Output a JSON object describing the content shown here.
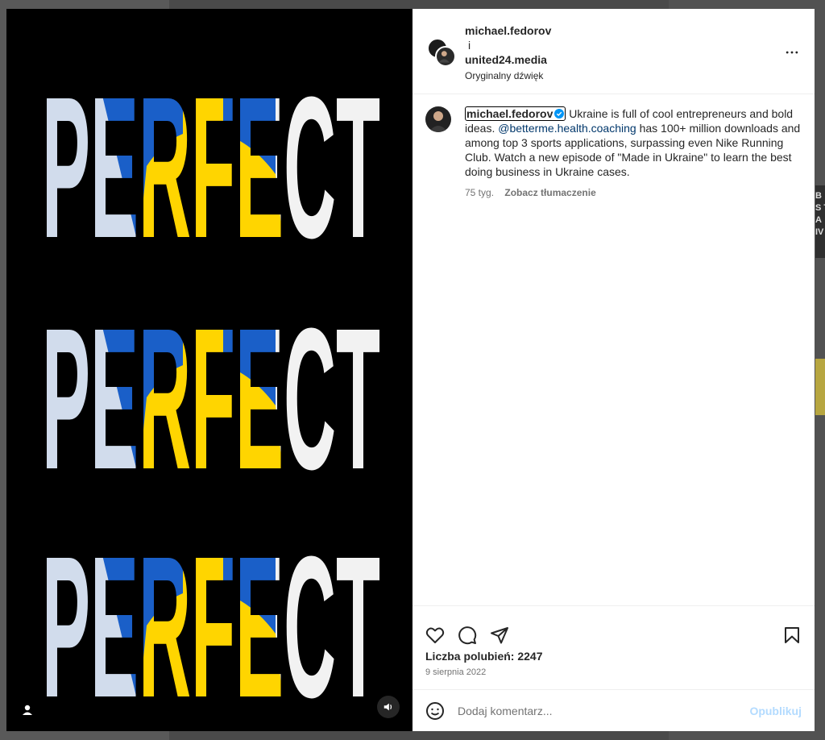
{
  "post": {
    "author": "michael.fedorov",
    "joiner": "i",
    "coauthor": "united24.media",
    "audio": "Oryginalny dźwięk"
  },
  "caption": {
    "user": "michael.fedorov",
    "text_before_mention": "Ukraine is full of cool entrepreneurs and bold ideas.",
    "mention": "@betterme.health.coaching",
    "text_after_mention": "has 100+ million downloads and among top 3 sports applications, surpassing even Nike Running Club. Watch a new episode of \"Made in Ukraine\" to learn the best doing business in Ukraine cases.",
    "age": "75 tyg.",
    "translate": "Zobacz tłumaczenie"
  },
  "media": {
    "poster_word": "PERFECT",
    "colors": {
      "blue": "#1a5fc8",
      "yellow": "#ffd500",
      "white": "#f2f2f2",
      "black": "#000000"
    }
  },
  "stats": {
    "likes": "Liczba polubień: 2247",
    "date": "9 sierpnia 2022"
  },
  "comment": {
    "placeholder": "Dodaj komentarz...",
    "publish": "Opublikuj"
  },
  "background": {
    "side_text": "B\nS T\nA\nIV"
  },
  "icons": [
    "more-icon",
    "verified-icon",
    "heart-icon",
    "comment-icon",
    "share-icon",
    "bookmark-icon",
    "emoji-icon",
    "user-icon",
    "speaker-icon"
  ]
}
